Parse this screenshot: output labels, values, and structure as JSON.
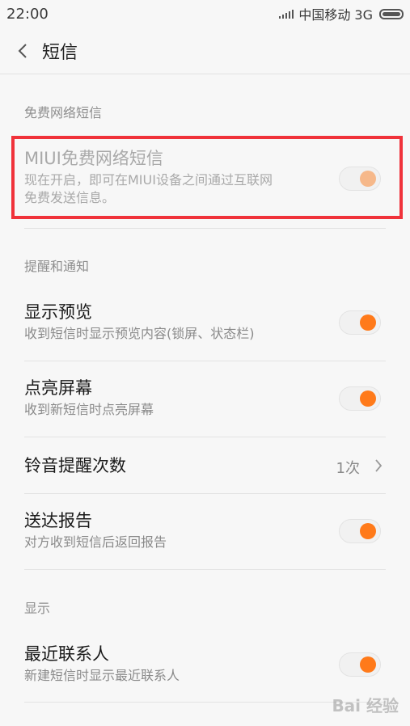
{
  "status_bar": {
    "time": "22:00",
    "carrier": "中国移动 3G",
    "signal_icon": "signal-bars-icon",
    "battery_icon": "battery-icon"
  },
  "header": {
    "back_icon": "chevron-left-icon",
    "title": "短信"
  },
  "sections": {
    "network": {
      "label": "免费网络短信",
      "item": {
        "title": "MIUI免费网络短信",
        "sub_line1": "现在开启，即可在MIUI设备之间通过互联网",
        "sub_line2": "免费发送信息。",
        "toggle_on": true,
        "disabled": true
      }
    },
    "notify": {
      "label": "提醒和通知",
      "items": [
        {
          "title": "显示预览",
          "sub": "收到短信时显示预览内容(锁屏、状态栏)",
          "toggle_on": true
        },
        {
          "title": "点亮屏幕",
          "sub": "收到新短信时点亮屏幕",
          "toggle_on": true
        },
        {
          "title": "铃音提醒次数",
          "value": "1次"
        },
        {
          "title": "送达报告",
          "sub": "对方收到短信后返回报告",
          "toggle_on": true
        }
      ]
    },
    "display": {
      "label": "显示",
      "items": [
        {
          "title": "最近联系人",
          "sub": "新建短信时显示最近联系人",
          "toggle_on": true
        }
      ]
    }
  },
  "colors": {
    "accent": "#ff7a1a",
    "highlight_box": "#f0323a",
    "background": "#f7f7f7"
  },
  "watermark": "Bai 经验"
}
